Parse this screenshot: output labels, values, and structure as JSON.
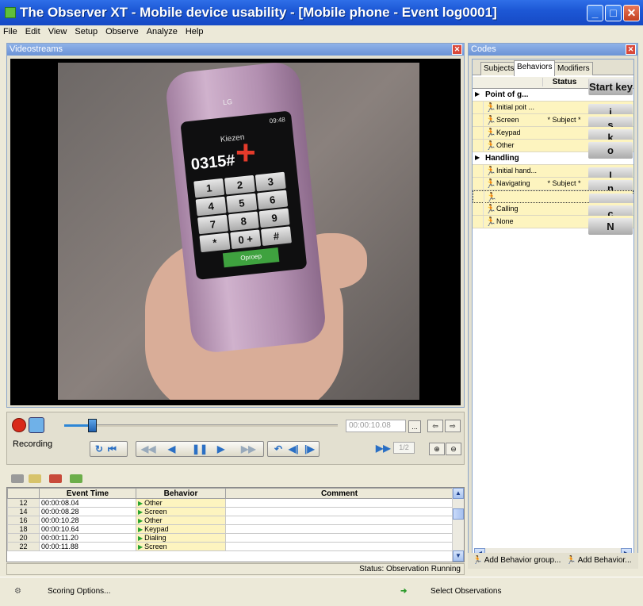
{
  "window": {
    "title": "The Observer XT - Mobile device usability - [Mobile phone - Event log0001]",
    "minimize_glyph": "_",
    "maximize_glyph": "□",
    "close_glyph": "✕"
  },
  "menu": [
    "File",
    "Edit",
    "View",
    "Setup",
    "Observe",
    "Analyze",
    "Help"
  ],
  "video_pane": {
    "title": "Videostreams",
    "phone": {
      "brand": "LG",
      "status_time": "09:48",
      "screen_title": "Kiezen",
      "dialed": "0315#",
      "keys": [
        "1",
        "2",
        "3",
        "4",
        "5",
        "6",
        "7",
        "8",
        "9",
        "*",
        "0 +",
        "#"
      ],
      "call_label": "Oproep"
    }
  },
  "playback": {
    "recording_label": "Recording",
    "time": "00:00:10.08",
    "time_more": "...",
    "ratio": "1/2",
    "position_fraction": 0.1
  },
  "event_log": {
    "columns": [
      "Event Time",
      "Behavior",
      "Comment"
    ],
    "rows": [
      {
        "n": "12",
        "time": "00:00:08.04",
        "behavior": "Other",
        "comment": ""
      },
      {
        "n": "14",
        "time": "00:00:08.28",
        "behavior": "Screen",
        "comment": ""
      },
      {
        "n": "16",
        "time": "00:00:10.28",
        "behavior": "Other",
        "comment": ""
      },
      {
        "n": "18",
        "time": "00:00:10.64",
        "behavior": "Keypad",
        "comment": ""
      },
      {
        "n": "20",
        "time": "00:00:11.20",
        "behavior": "Dialing",
        "comment": ""
      },
      {
        "n": "22",
        "time": "00:00:11.88",
        "behavior": "Screen",
        "comment": ""
      }
    ],
    "status": "Status: Observation Running"
  },
  "codes_pane": {
    "title": "Codes",
    "tabs": [
      "Subjects",
      "Behaviors",
      "Modifiers"
    ],
    "active_tab": "Behaviors",
    "columns": {
      "status": "Status",
      "start_key": "Start key"
    },
    "groups": [
      {
        "name": "Point of g...",
        "items": [
          {
            "name": "Initial poit ...",
            "status": "",
            "key": "i"
          },
          {
            "name": "Screen",
            "status": "* Subject *",
            "key": "s"
          },
          {
            "name": "Keypad",
            "status": "",
            "key": "k"
          },
          {
            "name": "Other",
            "status": "",
            "key": "o"
          }
        ]
      },
      {
        "name": "Handling",
        "items": [
          {
            "name": "Initial hand...",
            "status": "",
            "key": "l"
          },
          {
            "name": "Navigating",
            "status": "* Subject *",
            "key": "n"
          },
          {
            "name": "",
            "status": "",
            "key": ""
          },
          {
            "name": "Calling",
            "status": "",
            "key": "c"
          },
          {
            "name": "None",
            "status": "",
            "key": "N"
          }
        ]
      }
    ],
    "add_group_label": "Add Behavior group...",
    "add_behavior_label": "Add Behavior..."
  },
  "bottom": {
    "scoring_label": "Scoring Options...",
    "select_label": "Select Observations"
  },
  "colors": {
    "title_bar": "#1d58d6",
    "pane_header": "#7aa0de",
    "behavior_cell": "#fdf4bf",
    "record_red": "#d92a1a",
    "accent_blue": "#2c86d6"
  }
}
